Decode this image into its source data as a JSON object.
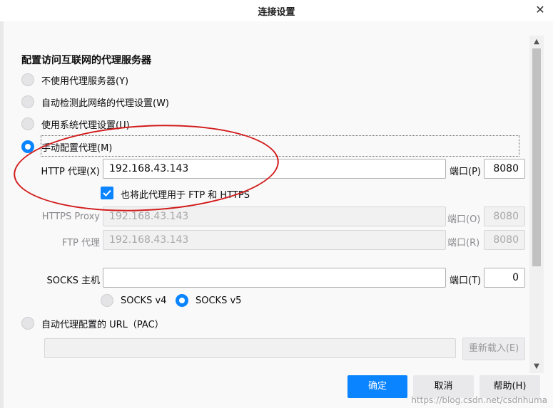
{
  "window": {
    "title": "连接设置",
    "close_symbol": "✕"
  },
  "section_title": "配置访问互联网的代理服务器",
  "proxy_options": {
    "no_proxy": "不使用代理服务器(Y)",
    "auto_detect": "自动检测此网络的代理设置(W)",
    "system": "使用系统代理设置(U)",
    "manual": "手动配置代理(M)",
    "selected": "manual"
  },
  "http": {
    "label": "HTTP 代理(X)",
    "value": "192.168.43.143",
    "port_label": "端口(P)",
    "port": "8080"
  },
  "share_proxy": {
    "label": "也将此代理用于 FTP 和 HTTPS",
    "checked": true
  },
  "https": {
    "label": "HTTPS Proxy",
    "value": "192.168.43.143",
    "port_label": "端口(O)",
    "port": "8080"
  },
  "ftp": {
    "label": "FTP 代理",
    "value": "192.168.43.143",
    "port_label": "端口(R)",
    "port": "8080"
  },
  "socks": {
    "label": "SOCKS 主机",
    "value": "",
    "port_label": "端口(T)",
    "port": "0",
    "v4": "SOCKS v4",
    "v5": "SOCKS v5",
    "selected_version": "v5"
  },
  "pac": {
    "label": "自动代理配置的 URL（PAC）",
    "value": "",
    "reload_label": "重新载入(E)"
  },
  "buttons": {
    "ok": "确定",
    "cancel": "取消",
    "help": "帮助(H)"
  },
  "watermark": "https://blog.csdn.net/csdnhuma",
  "colors": {
    "accent": "#0a84ff",
    "annotation": "#d21a1a"
  }
}
